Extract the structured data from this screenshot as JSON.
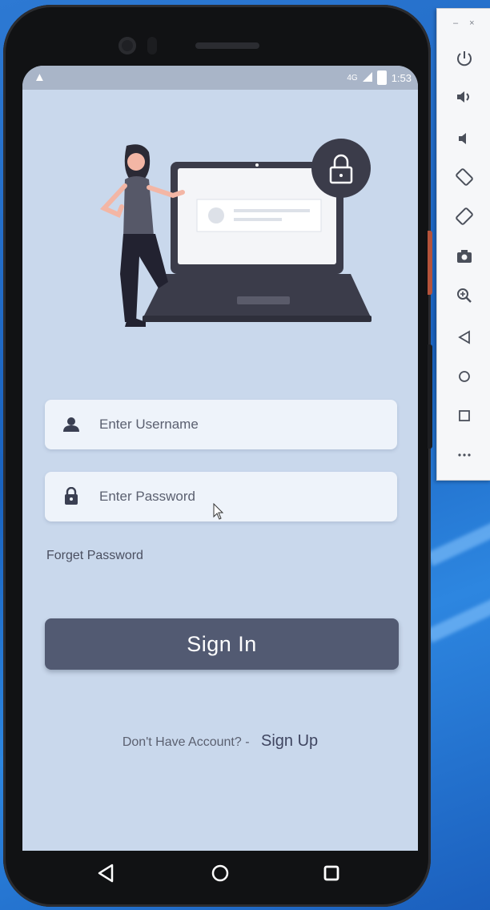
{
  "emulator_panel": {
    "minimize_label": "–",
    "close_label": "×",
    "tools": [
      {
        "name": "power-icon"
      },
      {
        "name": "volume-up-icon"
      },
      {
        "name": "volume-down-icon"
      },
      {
        "name": "rotate-left-icon"
      },
      {
        "name": "rotate-right-icon"
      },
      {
        "name": "camera-icon"
      },
      {
        "name": "zoom-icon"
      },
      {
        "name": "back-icon"
      },
      {
        "name": "home-icon"
      },
      {
        "name": "overview-icon"
      },
      {
        "name": "more-icon"
      }
    ]
  },
  "status_bar": {
    "warning": "▲",
    "network": "4G",
    "time": "1:53"
  },
  "login": {
    "username_placeholder": "Enter Username",
    "password_placeholder": "Enter Password",
    "forget_password": "Forget Password",
    "sign_in": "Sign In",
    "no_account": "Don't Have Account? -",
    "sign_up": "Sign Up"
  },
  "colors": {
    "screen_bg": "#c9d8ec",
    "button": "#525a72",
    "field_bg": "#eef3fa",
    "accent_dark": "#3f4560"
  }
}
